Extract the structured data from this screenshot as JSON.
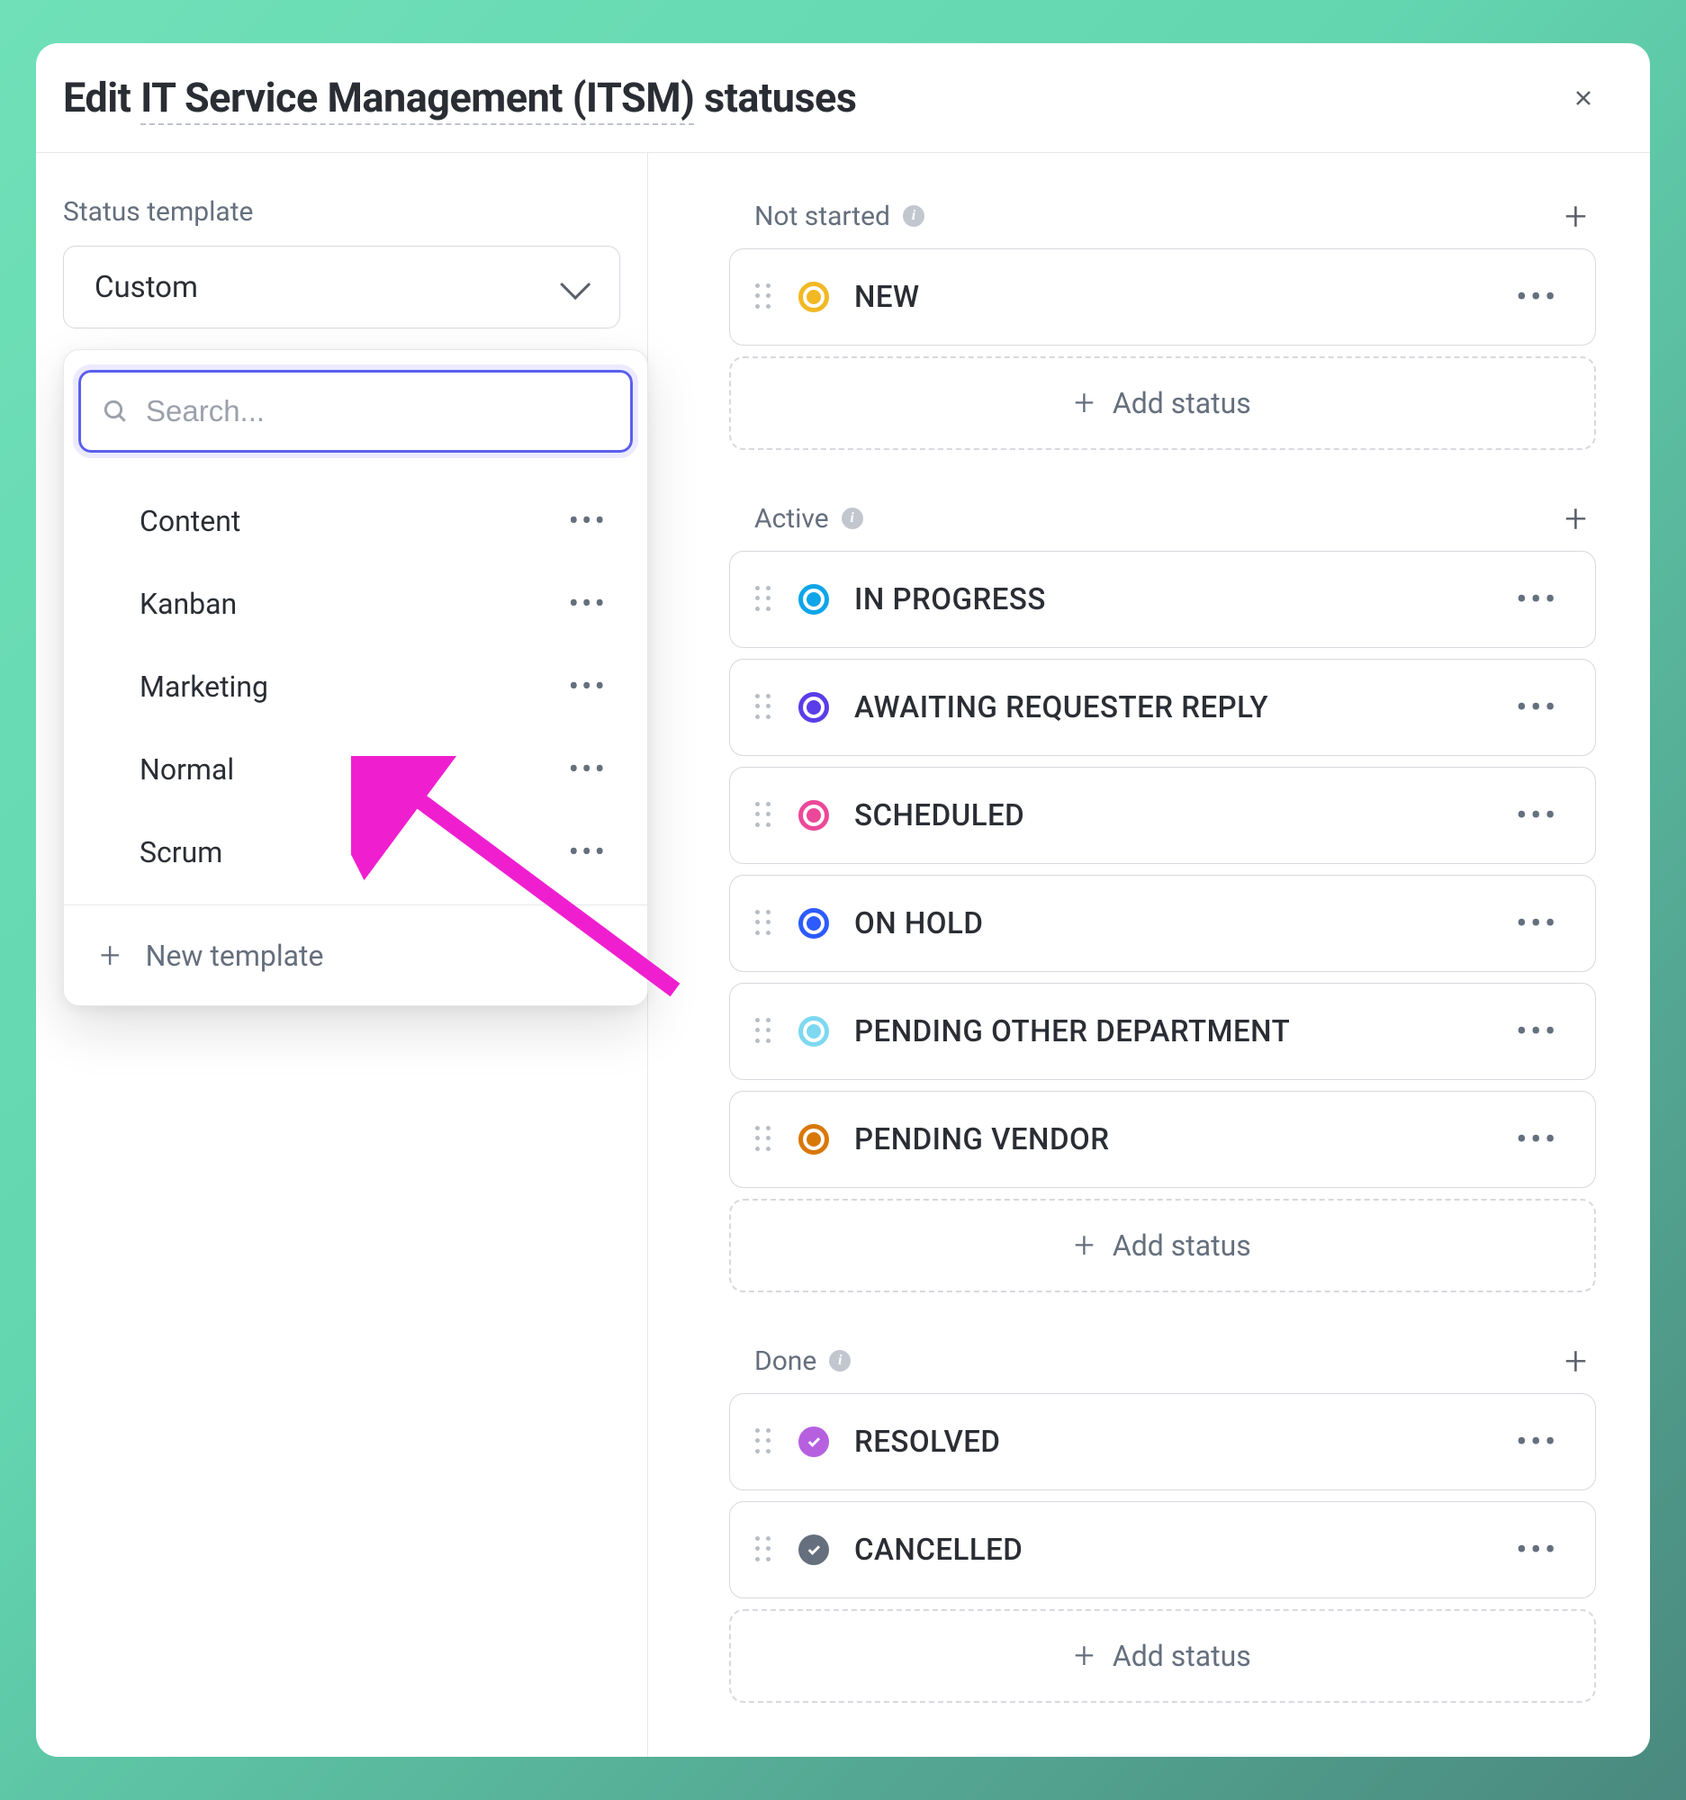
{
  "header": {
    "title_prefix": "Edit ",
    "title_underlined": "IT Service Management (ITSM)",
    "title_suffix": " statuses"
  },
  "left": {
    "section_label": "Status template",
    "selected": "Custom",
    "search_placeholder": "Search...",
    "templates": [
      "Content",
      "Kanban",
      "Marketing",
      "Normal",
      "Scrum"
    ],
    "new_template": "New template"
  },
  "groups": [
    {
      "name": "Not started",
      "statuses": [
        {
          "label": "NEW",
          "color": "#f2b824",
          "style": "ring"
        }
      ],
      "add_label": "Add status"
    },
    {
      "name": "Active",
      "statuses": [
        {
          "label": "IN PROGRESS",
          "color": "#0ea5e9",
          "style": "ring"
        },
        {
          "label": "AWAITING REQUESTER REPLY",
          "color": "#5b3de8",
          "style": "ring"
        },
        {
          "label": "SCHEDULED",
          "color": "#ec4899",
          "style": "ring"
        },
        {
          "label": "ON HOLD",
          "color": "#2d5bff",
          "style": "ring"
        },
        {
          "label": "PENDING OTHER DEPARTMENT",
          "color": "#7dd8f0",
          "style": "ring"
        },
        {
          "label": "PENDING VENDOR",
          "color": "#d97706",
          "style": "ring"
        }
      ],
      "add_label": "Add status"
    },
    {
      "name": "Done",
      "statuses": [
        {
          "label": "RESOLVED",
          "color": "#b660e0",
          "style": "check"
        },
        {
          "label": "CANCELLED",
          "color": "#656f7d",
          "style": "check"
        }
      ],
      "add_label": "Add status"
    }
  ]
}
